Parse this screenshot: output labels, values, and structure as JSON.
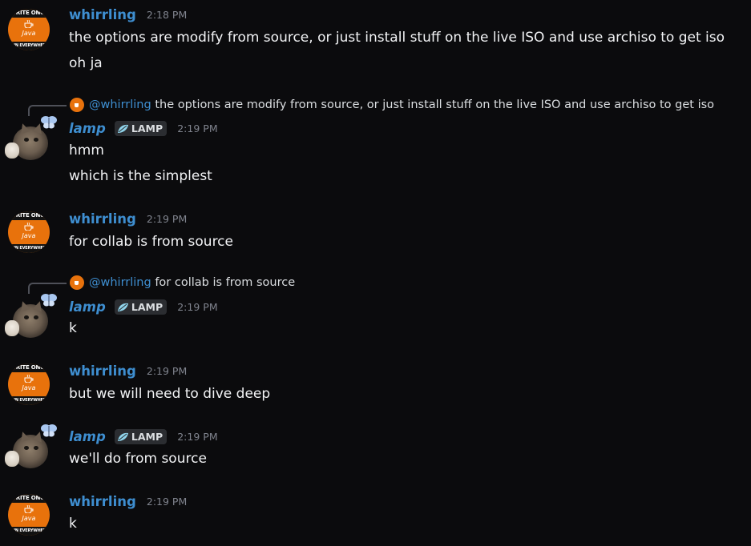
{
  "messages": [
    {
      "author": "whirrling",
      "time": "2:18 PM",
      "lines": [
        "the options are modify from source, or just install stuff on the live ISO and use archiso to get iso",
        "oh ja"
      ]
    },
    {
      "reply_to": {
        "mention": "@whirrling",
        "text": "the options are modify from source, or just install stuff on the live ISO and use archiso to get iso"
      },
      "author": "lamp",
      "tag": "LAMP",
      "time": "2:19 PM",
      "lines": [
        "hmm",
        "which is the simplest"
      ]
    },
    {
      "author": "whirrling",
      "time": "2:19 PM",
      "lines": [
        "for collab is from source"
      ]
    },
    {
      "reply_to": {
        "mention": "@whirrling",
        "text": "for collab is from source"
      },
      "author": "lamp",
      "tag": "LAMP",
      "time": "2:19 PM",
      "lines": [
        "k"
      ]
    },
    {
      "author": "whirrling",
      "time": "2:19 PM",
      "lines": [
        "but we will need to dive deep"
      ]
    },
    {
      "author": "lamp",
      "tag": "LAMP",
      "time": "2:19 PM",
      "lines": [
        "we'll do from source"
      ]
    },
    {
      "author": "whirrling",
      "time": "2:19 PM",
      "lines": [
        "k"
      ]
    }
  ],
  "avatars": {
    "java_top_text": "WRITE ONCE",
    "java_label": "Java",
    "java_bottom_text": "RUN EVERYWHERE"
  },
  "colors": {
    "background": "#0b0b0d",
    "username": "#3e8ed0",
    "timestamp": "#80848e",
    "message_text": "#f2f3f5",
    "java_orange": "#e8720c"
  },
  "icons": {
    "whirrling_avatar": "java-logo-avatar",
    "lamp_avatar": "cat-photo-avatar",
    "tag_icon": "leaf-icon"
  }
}
